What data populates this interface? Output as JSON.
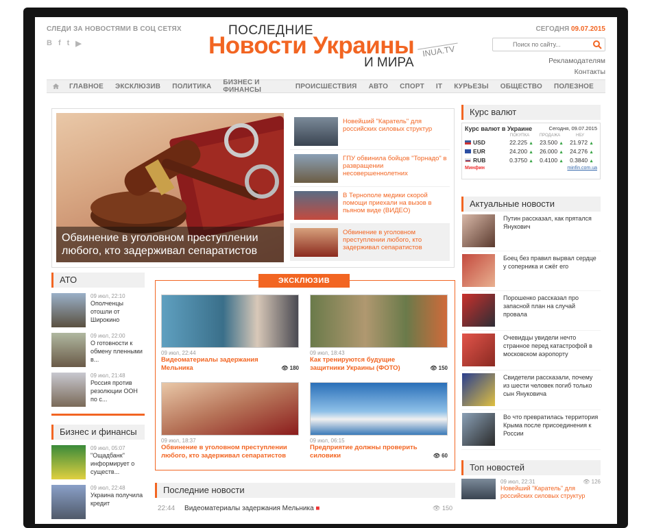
{
  "header": {
    "social_title": "СЛЕДИ ЗА НОВОСТЯМИ В СОЦ СЕТЯХ",
    "social_icons": [
      "В",
      "f",
      "t",
      "▶"
    ],
    "logo_line1": "ПОСЛЕДНИЕ",
    "logo_line2": "Новости Украины",
    "logo_line3": "И МИРА",
    "logo_badge": "INUA.TV",
    "today_label": "СЕГОДНЯ",
    "today_date": "09.07.2015",
    "search_placeholder": "Поиск по сайту...",
    "link_advertisers": "Рекламодателям",
    "link_contacts": "Контакты"
  },
  "nav": [
    "ГЛАВНОЕ",
    "ЭКСКЛЮЗИВ",
    "ПОЛИТИКА",
    "БИЗНЕС И ФИНАНСЫ",
    "ПРОИСШЕСТВИЯ",
    "АВТО",
    "СПОРТ",
    "IT",
    "КУРЬЕЗЫ",
    "ОБЩЕСТВО",
    "ПОЛЕЗНОЕ"
  ],
  "hero": {
    "caption": "Обвинение в уголовном преступлении любого, кто задерживал сепаратистов",
    "side_items": [
      "Новейший \"Каратель\" для российских силовых структур",
      "ГПУ обвинила бойцов \"Торнадо\" в развращении несовершеннолетних",
      "В Тернополе медики скорой помощи приехали на вызов в пьяном виде (ВИДЕО)",
      "Обвинение в уголовном преступлении любого, кто задерживал сепаратистов"
    ]
  },
  "rates": {
    "widget_title": "Курс валют",
    "table_title": "Курс валют в Украине",
    "today": "Сегодня, 09.07.2015",
    "cols": [
      "ПОКУПКА",
      "ПРОДАЖА",
      "НБУ"
    ],
    "rows": [
      {
        "code": "USD",
        "buy": "22.225",
        "sell": "23.500",
        "nbu": "21.972"
      },
      {
        "code": "EUR",
        "buy": "24.200",
        "sell": "26.000",
        "nbu": "24.276"
      },
      {
        "code": "RUB",
        "buy": "0.3750",
        "sell": "0.4100",
        "nbu": "0.3840"
      }
    ],
    "footer_left": "Минфин",
    "footer_right": "minfin.com.ua"
  },
  "actual": {
    "title": "Актуальные новости",
    "items": [
      "Путин рассказал, как прятался Янукович",
      "Боец без правил вырвал сердце у соперника и сжёг его",
      "Порошенко рассказал про запасной план на случай провала",
      "Очевидцы увидели нечто странное перед катастрофой в московском аэропорту",
      "Свидетели рассказали, почему из шести человек погиб только сын Януковича",
      "Во что превратилась территория Крыма после присоединения к России"
    ]
  },
  "top": {
    "title": "Топ новостей",
    "item": {
      "date": "09 июл, 22:31",
      "views": "126",
      "text": "Новейший \"Каратель\" для российских силовых структур"
    }
  },
  "ato": {
    "title": "АТО",
    "items": [
      {
        "date": "09 июл, 22:10",
        "text": "Ополченцы отошли от Широкино"
      },
      {
        "date": "09 июл, 22:00",
        "text": "О готовности к обмену пленными в..."
      },
      {
        "date": "09 июл, 21:48",
        "text": "Россия против резолюции ООН по с..."
      }
    ]
  },
  "business": {
    "title": "Бизнес и финансы",
    "items": [
      {
        "date": "09 июл, 05:07",
        "text": "\"Ощадбанк\" информирует о существ..."
      },
      {
        "date": "09 июл, 22:48",
        "text": "Украина получила кредит"
      }
    ]
  },
  "exclusive": {
    "label": "ЭКСКЛЮЗИВ",
    "cards": [
      {
        "date": "09 июл, 22:44",
        "title": "Видеоматериалы задержания Мельника",
        "views": "180"
      },
      {
        "date": "09 июл, 18:43",
        "title": "Как тренируются будущие защитники Украины (ФОТО)",
        "views": "150"
      },
      {
        "date": "09 июл, 18:37",
        "title": "Обвинение в уголовном преступлении любого, кто задерживал сепаратистов",
        "views": ""
      },
      {
        "date": "09 июл, 06:15",
        "title": "Предприятие должны проверить силовики",
        "views": "60"
      }
    ]
  },
  "latest": {
    "title": "Последние новости",
    "rows": [
      {
        "time": "22:44",
        "text": "Видеоматериалы задержания Мельника",
        "views": "150"
      }
    ]
  },
  "colors": {
    "accent": "#f26522",
    "positive": "#3ba548"
  }
}
